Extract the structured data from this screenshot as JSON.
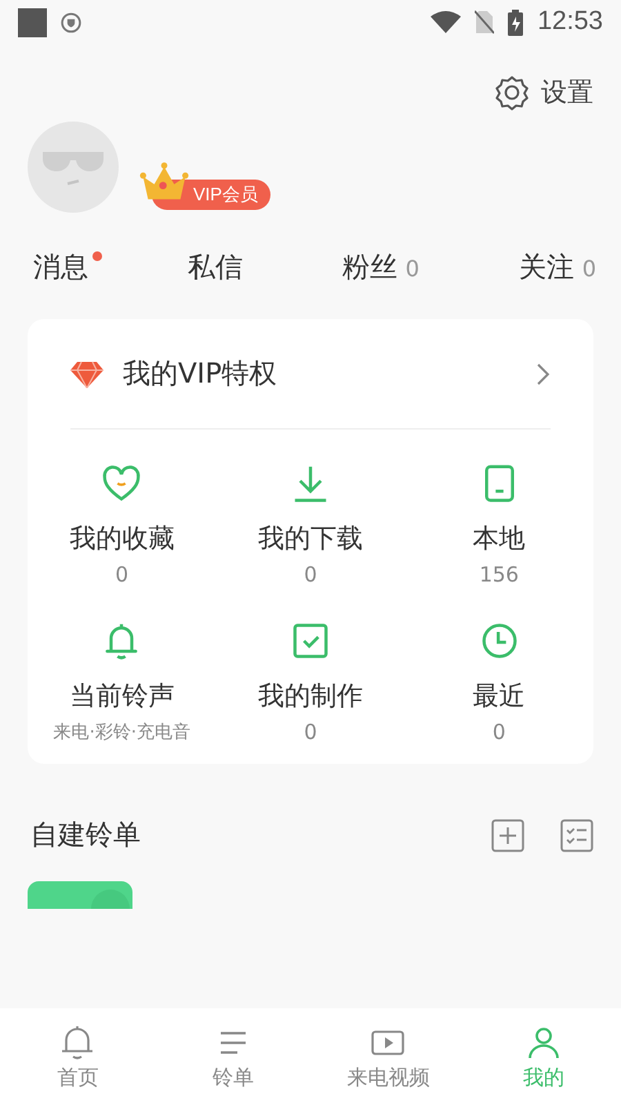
{
  "status_bar": {
    "time": "12:53"
  },
  "settings": {
    "label": "设置"
  },
  "profile": {
    "badge": "VIP会员"
  },
  "stats": [
    {
      "label": "消息",
      "unread": true
    },
    {
      "label": "私信",
      "unread": false
    },
    {
      "label": "粉丝",
      "count": "0",
      "unread": false
    },
    {
      "label": "关注",
      "count": "0",
      "unread": false
    }
  ],
  "vip_card": {
    "title": "我的VIP特权",
    "items": [
      {
        "label": "我的收藏",
        "value": "0"
      },
      {
        "label": "我的下载",
        "value": "0"
      },
      {
        "label": "本地",
        "value": "156"
      },
      {
        "label": "当前铃声",
        "value": "来电·彩铃·充电音"
      },
      {
        "label": "我的制作",
        "value": "0"
      },
      {
        "label": "最近",
        "value": "0"
      }
    ]
  },
  "playlists": {
    "title": "自建铃单"
  },
  "bottom_nav": [
    {
      "label": "首页",
      "selected": false
    },
    {
      "label": "铃单",
      "selected": false
    },
    {
      "label": "来电视频",
      "selected": false
    },
    {
      "label": "我的",
      "selected": true
    }
  ]
}
